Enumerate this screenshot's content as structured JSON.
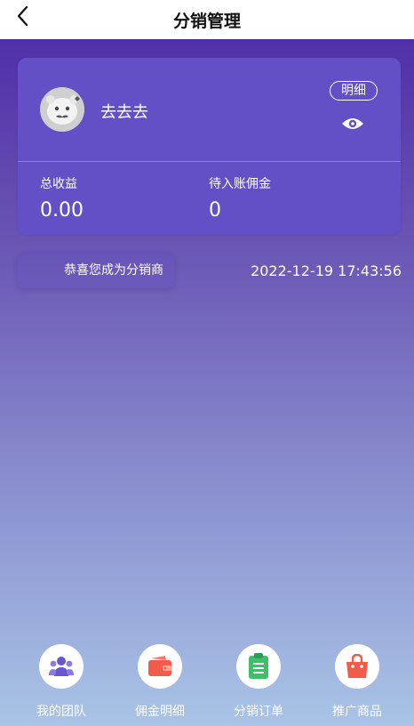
{
  "header": {
    "title": "分销管理",
    "back_icon": "chevron-left-icon"
  },
  "profile": {
    "username": "去去去",
    "detail_label": "明细",
    "eye_icon": "eye-icon"
  },
  "stats": {
    "total_income_label": "总收益",
    "total_income_value": "0.00",
    "pending_commission_label": "待入账佣金",
    "pending_commission_value": "0"
  },
  "notice": {
    "message": "恭喜您成为分销商",
    "timestamp": "2022-12-19 17:43:56"
  },
  "menu": {
    "items": [
      {
        "label": "我的团队",
        "icon": "team-icon",
        "color": "#6a55d0"
      },
      {
        "label": "佣金明细",
        "icon": "wallet-icon",
        "color": "#f25a4a"
      },
      {
        "label": "分销订单",
        "icon": "clipboard-icon",
        "color": "#3fbf6a"
      },
      {
        "label": "推广商品",
        "icon": "shopping-bag-icon",
        "color": "#f25a4a"
      }
    ]
  },
  "colors": {
    "accent": "#6450c6",
    "gradient_top": "#5030a8",
    "gradient_bottom": "#a9c4e6"
  }
}
